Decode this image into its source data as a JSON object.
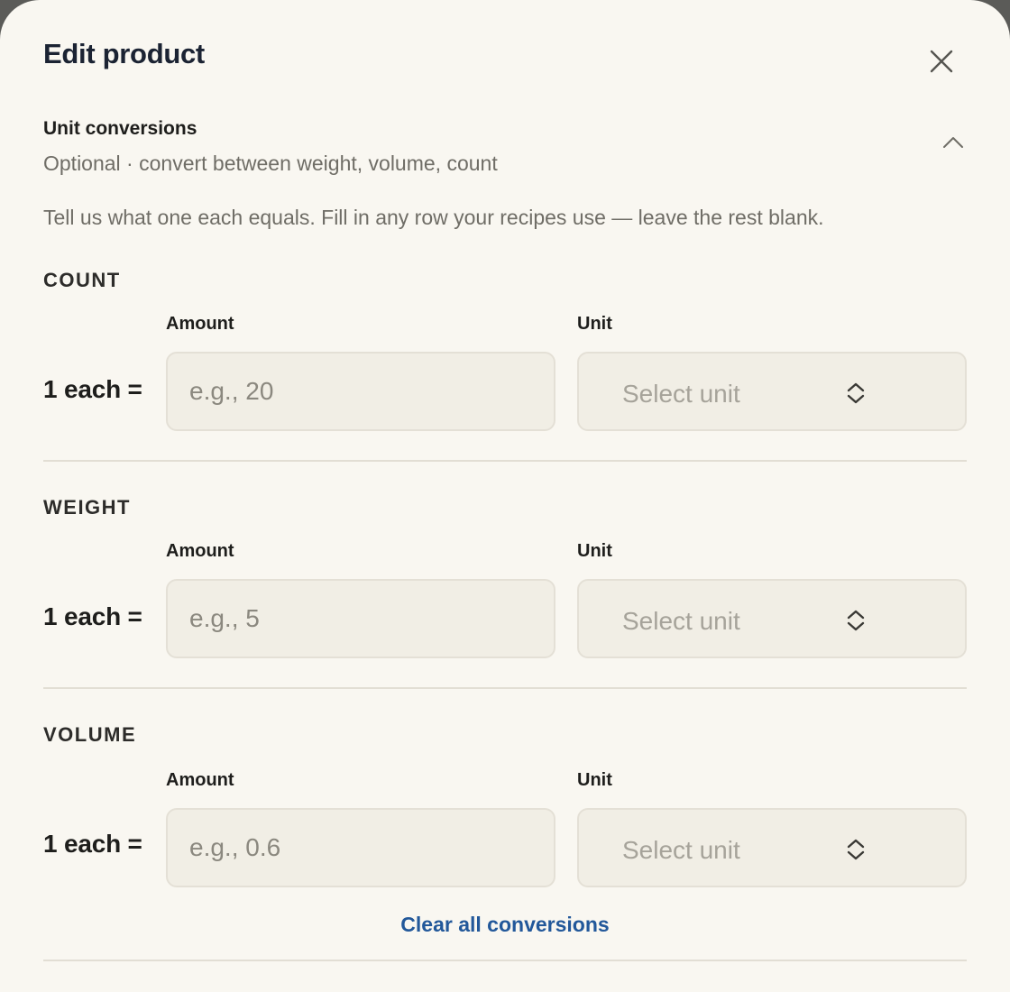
{
  "modal": {
    "title": "Edit product",
    "close_icon": "close-icon"
  },
  "section": {
    "title": "Unit conversions",
    "subtitle": "Optional · convert between weight, volume, count",
    "toggle_icon": "chevron-up-icon",
    "intro": "Tell us what one each equals. Fill in any row your recipes use — leave the rest blank."
  },
  "groups": [
    {
      "heading": "COUNT",
      "amount_label": "Amount",
      "unit_label": "Unit",
      "equation": "1 each =",
      "amount_value": "",
      "amount_placeholder": "e.g., 20",
      "unit_placeholder": "Select unit"
    },
    {
      "heading": "WEIGHT",
      "amount_label": "Amount",
      "unit_label": "Unit",
      "equation": "1 each =",
      "amount_value": "",
      "amount_placeholder": "e.g., 5",
      "unit_placeholder": "Select unit"
    },
    {
      "heading": "VOLUME",
      "amount_label": "Amount",
      "unit_label": "Unit",
      "equation": "1 each =",
      "amount_value": "",
      "amount_placeholder": "e.g., 0.6",
      "unit_placeholder": "Select unit"
    }
  ],
  "actions": {
    "clear_label": "Clear all conversions"
  },
  "colors": {
    "modal_background": "#f9f7f1",
    "input_background": "#f1eee5",
    "link": "#22589a",
    "title": "#1b2333"
  }
}
